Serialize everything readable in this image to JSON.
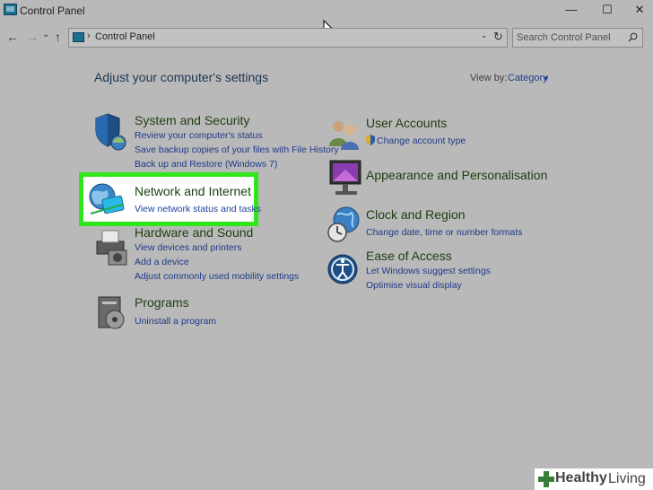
{
  "window": {
    "title": "Control Panel",
    "minimize": "—",
    "maximize": "☐",
    "close": "✕"
  },
  "nav": {
    "back": "←",
    "forward": "→",
    "recent": "⌄",
    "up": "↑"
  },
  "address": {
    "separator": "›",
    "path": "Control Panel",
    "dropdown": "⌄",
    "refresh": "↻"
  },
  "search": {
    "placeholder": "Search Control Panel"
  },
  "header": {
    "title": "Adjust your computer's settings",
    "view_by_label": "View by:",
    "view_by_value": "Category",
    "view_by_caret": "▼"
  },
  "categories": {
    "system": {
      "title": "System and Security",
      "links": [
        "Review your computer's status",
        "Save backup copies of your files with File History",
        "Back up and Restore (Windows 7)"
      ]
    },
    "network": {
      "title": "Network and Internet",
      "links": [
        "View network status and tasks"
      ]
    },
    "hardware": {
      "title": "Hardware and Sound",
      "links": [
        "View devices and printers",
        "Add a device",
        "Adjust commonly used mobility settings"
      ]
    },
    "programs": {
      "title": "Programs",
      "links": [
        "Uninstall a program"
      ]
    },
    "users": {
      "title": "User Accounts",
      "links": [
        "Change account type"
      ]
    },
    "appearance": {
      "title": "Appearance and Personalisation",
      "links": []
    },
    "clock": {
      "title": "Clock and Region",
      "links": [
        "Change date, time or number formats"
      ]
    },
    "ease": {
      "title": "Ease of Access",
      "links": [
        "Let Windows suggest settings",
        "Optimise visual display"
      ]
    }
  },
  "watermark": {
    "brand_bold": "Healthy",
    "brand_regular": "Living"
  },
  "colors": {
    "background": "#b9b9b9",
    "highlight_border": "#2ee619",
    "link": "#1e3a8a",
    "category_title": "#1e3d10"
  }
}
